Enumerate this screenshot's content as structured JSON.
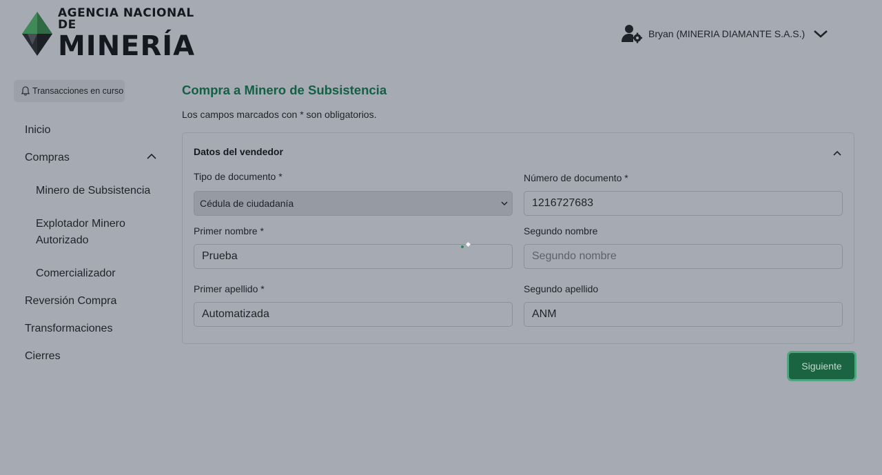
{
  "header": {
    "logo_line1": "AGENCIA NACIONAL DE",
    "logo_line2": "MINERÍA",
    "user_label": "Bryan (MINERIA DIAMANTE S.A.S.)",
    "user_icon": "user-gear-icon"
  },
  "sidebar": {
    "transactions_label": "Transacciones en curso",
    "items": [
      {
        "label": "Inicio"
      },
      {
        "label": "Compras"
      },
      {
        "label": "Minero de Subsistencia"
      },
      {
        "label": "Explotador Minero Autorizado"
      },
      {
        "label": "Comercializador"
      },
      {
        "label": "Reversión Compra"
      },
      {
        "label": "Transformaciones"
      },
      {
        "label": "Cierres"
      }
    ]
  },
  "main": {
    "title": "Compra a Minero de Subsistencia",
    "required_note": "Los campos marcados con * son obligatorios.",
    "section_title": "Datos del vendedor",
    "fields": {
      "doc_type": {
        "label": "Tipo de documento *",
        "value": "Cédula de ciudadanía"
      },
      "doc_number": {
        "label": "Número de documento *",
        "value": "1216727683"
      },
      "first_name": {
        "label": "Primer nombre *",
        "value": "Prueba"
      },
      "second_name": {
        "label": "Segundo nombre",
        "value": "",
        "placeholder": "Segundo nombre"
      },
      "first_surname": {
        "label": "Primer apellido *",
        "value": "Automatizada"
      },
      "second_surname": {
        "label": "Segundo apellido",
        "value": "ANM"
      }
    },
    "next_label": "Siguiente"
  },
  "colors": {
    "accent": "#136044",
    "button": "#1b6442",
    "overlay_bg": "#a6aab2"
  }
}
